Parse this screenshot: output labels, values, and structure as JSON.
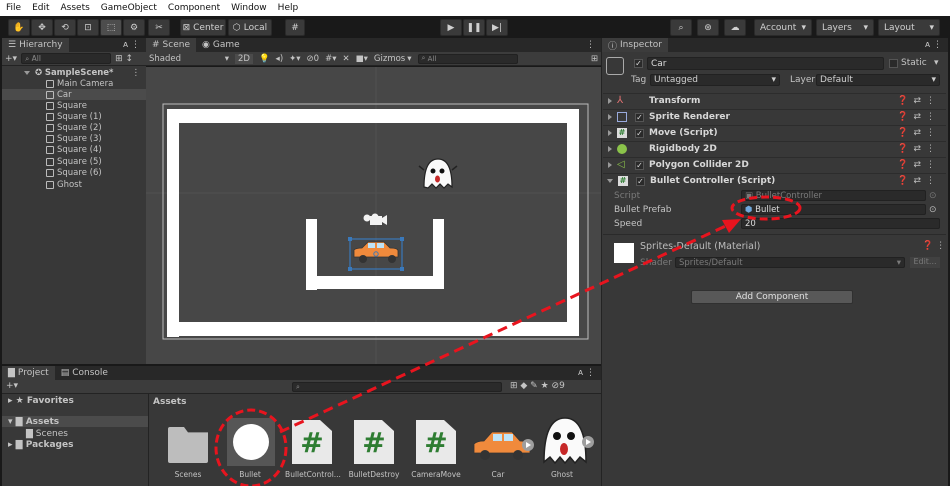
{
  "menu": [
    "File",
    "Edit",
    "Assets",
    "GameObject",
    "Component",
    "Window",
    "Help"
  ],
  "toolbar": {
    "pivot_label": "Center",
    "space_label": "Local",
    "account_label": "Account",
    "layers_label": "Layers",
    "layout_label": "Layout"
  },
  "hierarchy": {
    "tab_label": "Hierarchy",
    "search_placeholder": "All",
    "scene_name": "SampleScene*",
    "items": [
      "Main Camera",
      "Car",
      "Square",
      "Square (1)",
      "Square (2)",
      "Square (3)",
      "Square (4)",
      "Square (5)",
      "Square (6)",
      "Ghost"
    ],
    "selected": "Car"
  },
  "scene": {
    "scene_tab": "Scene",
    "game_tab": "Game",
    "shading_mode": "Shaded",
    "mode_2d": "2D",
    "hidden_count": "0",
    "gizmos_label": "Gizmos",
    "search_placeholder": "All"
  },
  "inspector": {
    "tab_label": "Inspector",
    "object_name": "Car",
    "static_label": "Static",
    "tag_label": "Tag",
    "tag_value": "Untagged",
    "layer_label": "Layer",
    "layer_value": "Default",
    "components": [
      "Transform",
      "Sprite Renderer",
      "Move (Script)",
      "Rigidbody 2D",
      "Polygon Collider 2D",
      "Bullet Controller (Script)"
    ],
    "script_label": "Script",
    "script_value": "BulletController",
    "prefab_label": "Bullet Prefab",
    "prefab_value": "Bullet",
    "speed_label": "Speed",
    "speed_value": "20",
    "material_name": "Sprites-Default (Material)",
    "shader_label": "Shader",
    "shader_value": "Sprites/Default",
    "edit_label": "Edit...",
    "add_component_label": "Add Component"
  },
  "project": {
    "project_tab": "Project",
    "console_tab": "Console",
    "hidden_count": "9",
    "favorites_label": "Favorites",
    "assets_label": "Assets",
    "scenes_label": "Scenes",
    "packages_label": "Packages",
    "breadcrumb": "Assets",
    "assets": [
      "Scenes",
      "Bullet",
      "BulletControl...",
      "BulletDestroy",
      "CameraMove",
      "Car",
      "Ghost"
    ]
  },
  "colors": {
    "annotation": "#e8141e",
    "selection": "#3a79bb"
  }
}
